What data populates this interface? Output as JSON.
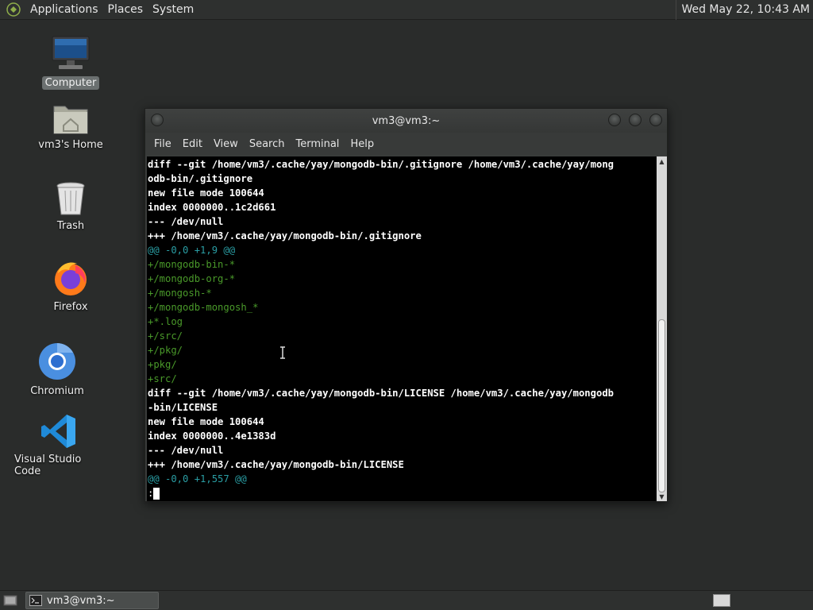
{
  "top_panel": {
    "menus": [
      "Applications",
      "Places",
      "System"
    ],
    "clock": "Wed May 22, 10:43 AM"
  },
  "desktop": {
    "icons": [
      {
        "label": "Computer",
        "icon": "computer-icon",
        "selected": true
      },
      {
        "label": "vm3's Home",
        "icon": "home-folder-icon"
      },
      {
        "label": "Trash",
        "icon": "trash-icon"
      },
      {
        "label": "Firefox",
        "icon": "firefox-icon"
      },
      {
        "label": "Chromium",
        "icon": "chromium-icon"
      },
      {
        "label": "Visual Studio Code",
        "icon": "vscode-icon"
      }
    ]
  },
  "window": {
    "title": "vm3@vm3:~",
    "menus": [
      "File",
      "Edit",
      "View",
      "Search",
      "Terminal",
      "Help"
    ],
    "lines": [
      {
        "text": "diff --git /home/vm3/.cache/yay/mongodb-bin/.gitignore /home/vm3/.cache/yay/mong",
        "style": "bold"
      },
      {
        "text": "odb-bin/.gitignore",
        "style": "bold"
      },
      {
        "text": "new file mode 100644",
        "style": "bold"
      },
      {
        "text": "index 0000000..1c2d661",
        "style": "bold"
      },
      {
        "text": "--- /dev/null",
        "style": "bold"
      },
      {
        "text": "+++ /home/vm3/.cache/yay/mongodb-bin/.gitignore",
        "style": "bold"
      },
      {
        "text": "@@ -0,0 +1,9 @@",
        "style": "cyan"
      },
      {
        "text": "+/mongodb-bin-*",
        "style": "green"
      },
      {
        "text": "+/mongodb-org-*",
        "style": "green"
      },
      {
        "text": "+/mongosh-*",
        "style": "green"
      },
      {
        "text": "+/mongodb-mongosh_*",
        "style": "green"
      },
      {
        "text": "+*.log",
        "style": "green"
      },
      {
        "text": "+/src/",
        "style": "green"
      },
      {
        "text": "+/pkg/",
        "style": "green"
      },
      {
        "text": "+pkg/",
        "style": "green"
      },
      {
        "text": "+src/",
        "style": "green"
      },
      {
        "text": "diff --git /home/vm3/.cache/yay/mongodb-bin/LICENSE /home/vm3/.cache/yay/mongodb",
        "style": "bold"
      },
      {
        "text": "-bin/LICENSE",
        "style": "bold"
      },
      {
        "text": "new file mode 100644",
        "style": "bold"
      },
      {
        "text": "index 0000000..4e1383d",
        "style": "bold"
      },
      {
        "text": "--- /dev/null",
        "style": "bold"
      },
      {
        "text": "+++ /home/vm3/.cache/yay/mongodb-bin/LICENSE",
        "style": "bold"
      },
      {
        "text": "@@ -0,0 +1,557 @@",
        "style": "cyan"
      }
    ],
    "prompt": ":"
  },
  "taskbar": {
    "task_label": "vm3@vm3:~"
  },
  "colors": {
    "diff_add": "#4a9a2a",
    "diff_hunk": "#2a9ea4",
    "terminal_bg": "#000000"
  }
}
